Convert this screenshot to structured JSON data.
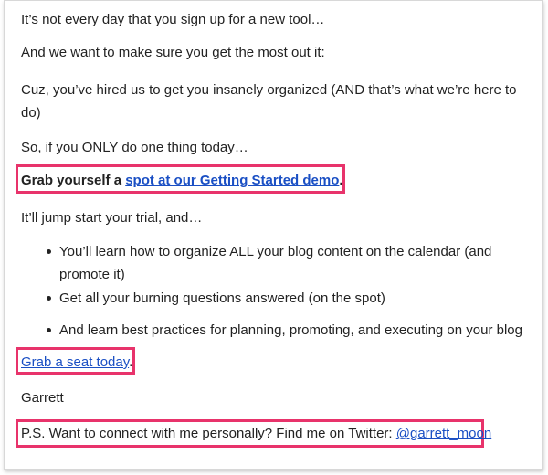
{
  "email": {
    "paragraphs": {
      "p1": "It’s not every day that you sign up for a new tool…",
      "p2": "And we want to make sure you get the most out it:",
      "p3": "Cuz, you’ve hired us to get you insanely organized (AND that’s what we’re here to do)",
      "p4": "So, if you ONLY do one thing today…",
      "p5_prefix": "Grab yourself a ",
      "p5_link": "spot at our Getting Started demo",
      "p5_suffix": ".",
      "p6": "It’ll jump start your trial, and…",
      "p7_link": "Grab a seat today",
      "p7_suffix": ".",
      "p8": "Garrett",
      "p9_prefix": "P.S. Want to connect with me personally? Find me on Twitter: ",
      "p9_link": "@garrett_moon"
    },
    "bullets": [
      "You’ll learn how to organize ALL your blog content on the calendar (and promote it)",
      "Get all your burning questions answered (on the spot)",
      "And learn best practices for planning, promoting, and executing on your blog"
    ]
  },
  "colors": {
    "highlight_border": "#e8336b",
    "link": "#1a4fc4",
    "text": "#222222"
  }
}
